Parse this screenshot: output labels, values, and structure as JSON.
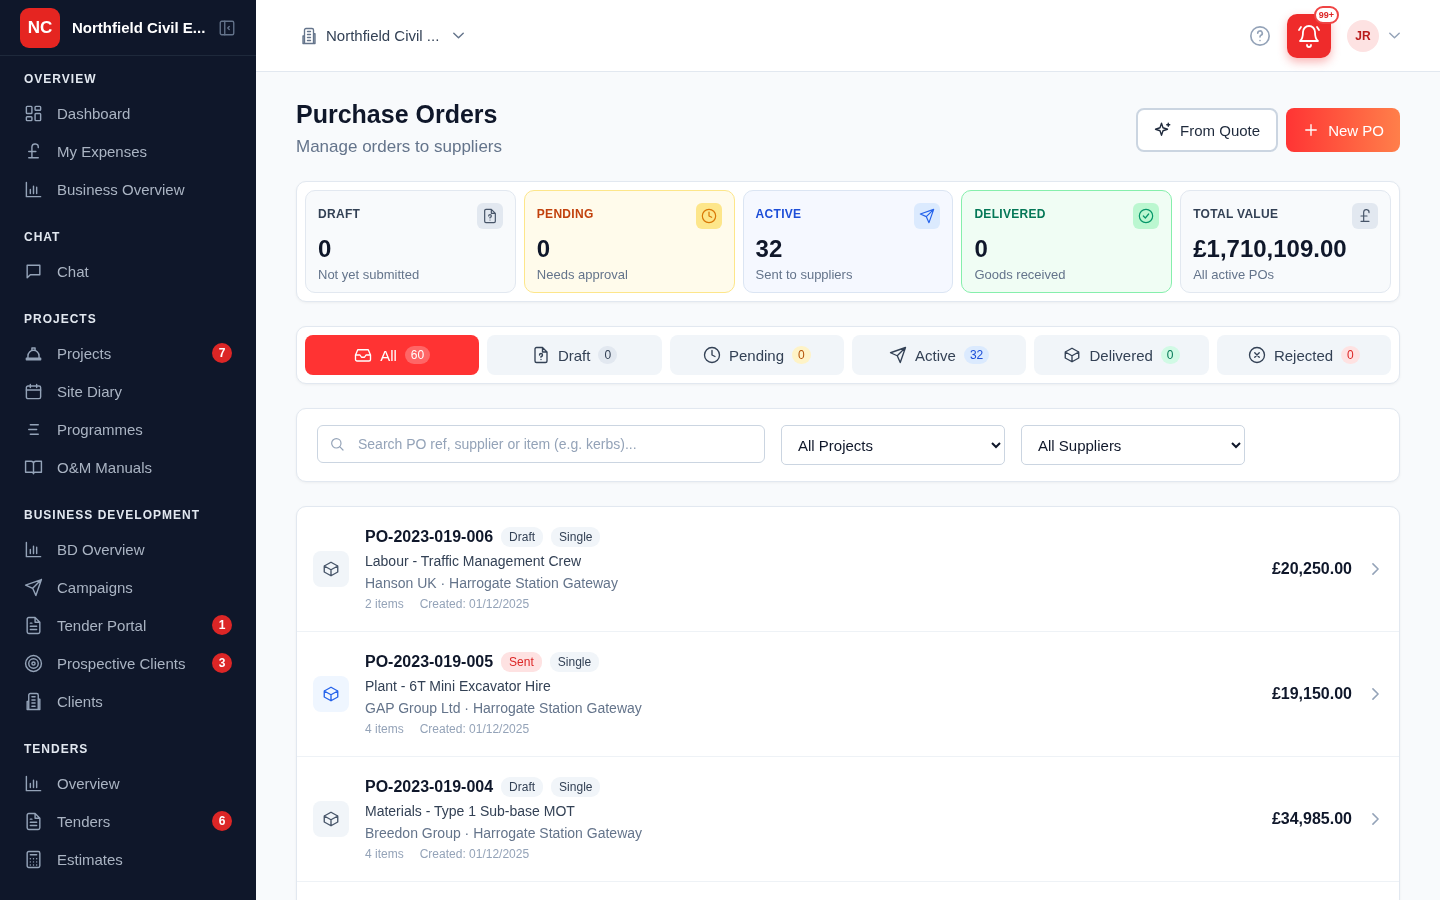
{
  "sidebar": {
    "logo": "NC",
    "org_name": "Northfield Civil E...",
    "sections": [
      {
        "title": "OVERVIEW",
        "items": [
          {
            "label": "Dashboard"
          },
          {
            "label": "My Expenses"
          },
          {
            "label": "Business Overview"
          }
        ]
      },
      {
        "title": "CHAT",
        "items": [
          {
            "label": "Chat"
          }
        ]
      },
      {
        "title": "PROJECTS",
        "items": [
          {
            "label": "Projects",
            "badge": "7"
          },
          {
            "label": "Site Diary"
          },
          {
            "label": "Programmes"
          },
          {
            "label": "O&M Manuals"
          }
        ]
      },
      {
        "title": "BUSINESS DEVELOPMENT",
        "items": [
          {
            "label": "BD Overview"
          },
          {
            "label": "Campaigns"
          },
          {
            "label": "Tender Portal",
            "badge": "1"
          },
          {
            "label": "Prospective Clients",
            "badge": "3"
          },
          {
            "label": "Clients"
          }
        ]
      },
      {
        "title": "TENDERS",
        "items": [
          {
            "label": "Overview"
          },
          {
            "label": "Tenders",
            "badge": "6"
          },
          {
            "label": "Estimates"
          }
        ]
      }
    ]
  },
  "header": {
    "org_selector": "Northfield Civil ...",
    "notification_badge": "99+",
    "avatar": "JR"
  },
  "page": {
    "title": "Purchase Orders",
    "subtitle": "Manage orders to suppliers",
    "buttons": [
      {
        "label": "From Quote",
        "kind": "secondary"
      },
      {
        "label": "New PO",
        "kind": "primary"
      }
    ]
  },
  "stats": [
    {
      "label": "DRAFT",
      "value": "0",
      "caption": "Not yet submitted",
      "kind": "neutral"
    },
    {
      "label": "PENDING",
      "value": "0",
      "caption": "Needs approval",
      "kind": "pending"
    },
    {
      "label": "ACTIVE",
      "value": "32",
      "caption": "Sent to suppliers",
      "kind": "active"
    },
    {
      "label": "DELIVERED",
      "value": "0",
      "caption": "Goods received",
      "kind": "delivered"
    },
    {
      "label": "TOTAL VALUE",
      "value": "£1,710,109.00",
      "caption": "All active POs",
      "kind": "total"
    }
  ],
  "tabs": [
    {
      "label": "All",
      "count": "60",
      "kind": "all",
      "selected": true
    },
    {
      "label": "Draft",
      "count": "0",
      "kind": "draft",
      "selected": false
    },
    {
      "label": "Pending",
      "count": "0",
      "kind": "pending",
      "selected": false
    },
    {
      "label": "Active",
      "count": "32",
      "kind": "active",
      "selected": false
    },
    {
      "label": "Delivered",
      "count": "0",
      "kind": "delivered",
      "selected": false
    },
    {
      "label": "Rejected",
      "count": "0",
      "kind": "rejected",
      "selected": false
    }
  ],
  "filters": {
    "search": {
      "placeholder": "Search PO ref, supplier or item (e.g. kerbs)..."
    },
    "project": "All Projects",
    "supplier": "All Suppliers"
  },
  "orders": [
    {
      "ref": "PO-2023-019-006",
      "tags": [
        {
          "label": "Draft",
          "kind": "neutral"
        },
        {
          "label": "Single",
          "kind": "neutral"
        }
      ],
      "title": "Labour - Traffic Management Crew",
      "supplier": "Hanson UK · Harrogate Station Gateway",
      "items": "2 items",
      "created": "Created: 01/12/2025",
      "amount": "£20,250.00",
      "kind": "draft"
    },
    {
      "ref": "PO-2023-019-005",
      "tags": [
        {
          "label": "Sent",
          "kind": "danger"
        },
        {
          "label": "Single",
          "kind": "neutral"
        }
      ],
      "title": "Plant - 6T Mini Excavator Hire",
      "supplier": "GAP Group Ltd · Harrogate Station Gateway",
      "items": "4 items",
      "created": "Created: 01/12/2025",
      "amount": "£19,150.00",
      "kind": "sent"
    },
    {
      "ref": "PO-2023-019-004",
      "tags": [
        {
          "label": "Draft",
          "kind": "neutral"
        },
        {
          "label": "Single",
          "kind": "neutral"
        }
      ],
      "title": "Materials - Type 1 Sub-base MOT",
      "supplier": "Breedon Group · Harrogate Station Gateway",
      "items": "4 items",
      "created": "Created: 01/12/2025",
      "amount": "£34,985.00",
      "kind": "draft"
    }
  ]
}
